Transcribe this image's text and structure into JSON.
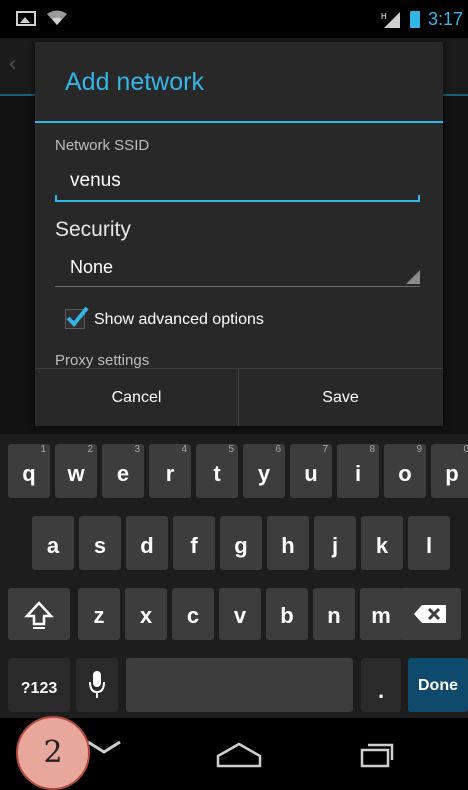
{
  "status_bar": {
    "time": "3:17",
    "network_type": "H"
  },
  "dialog": {
    "title": "Add network",
    "ssid_label": "Network SSID",
    "ssid_value": "venus",
    "security_label": "Security",
    "security_value": "None",
    "show_advanced_label": "Show advanced options",
    "show_advanced_checked": true,
    "proxy_label": "Proxy settings",
    "cancel_label": "Cancel",
    "save_label": "Save"
  },
  "keyboard": {
    "row1": [
      {
        "key": "q",
        "hint": "1"
      },
      {
        "key": "w",
        "hint": "2"
      },
      {
        "key": "e",
        "hint": "3"
      },
      {
        "key": "r",
        "hint": "4"
      },
      {
        "key": "t",
        "hint": "5"
      },
      {
        "key": "y",
        "hint": "6"
      },
      {
        "key": "u",
        "hint": "7"
      },
      {
        "key": "i",
        "hint": "8"
      },
      {
        "key": "o",
        "hint": "9"
      },
      {
        "key": "p",
        "hint": "0"
      }
    ],
    "row2": [
      "a",
      "s",
      "d",
      "f",
      "g",
      "h",
      "j",
      "k",
      "l"
    ],
    "row3": [
      "z",
      "x",
      "c",
      "v",
      "b",
      "n",
      "m"
    ],
    "symbols_label": "?123",
    "period_label": ".",
    "done_label": "Done"
  },
  "step_badge": "2",
  "colors": {
    "accent": "#33b5e5",
    "dialog_bg": "#282828",
    "key_bg": "#3d3d3d",
    "done_bg": "#0f4a6c"
  }
}
